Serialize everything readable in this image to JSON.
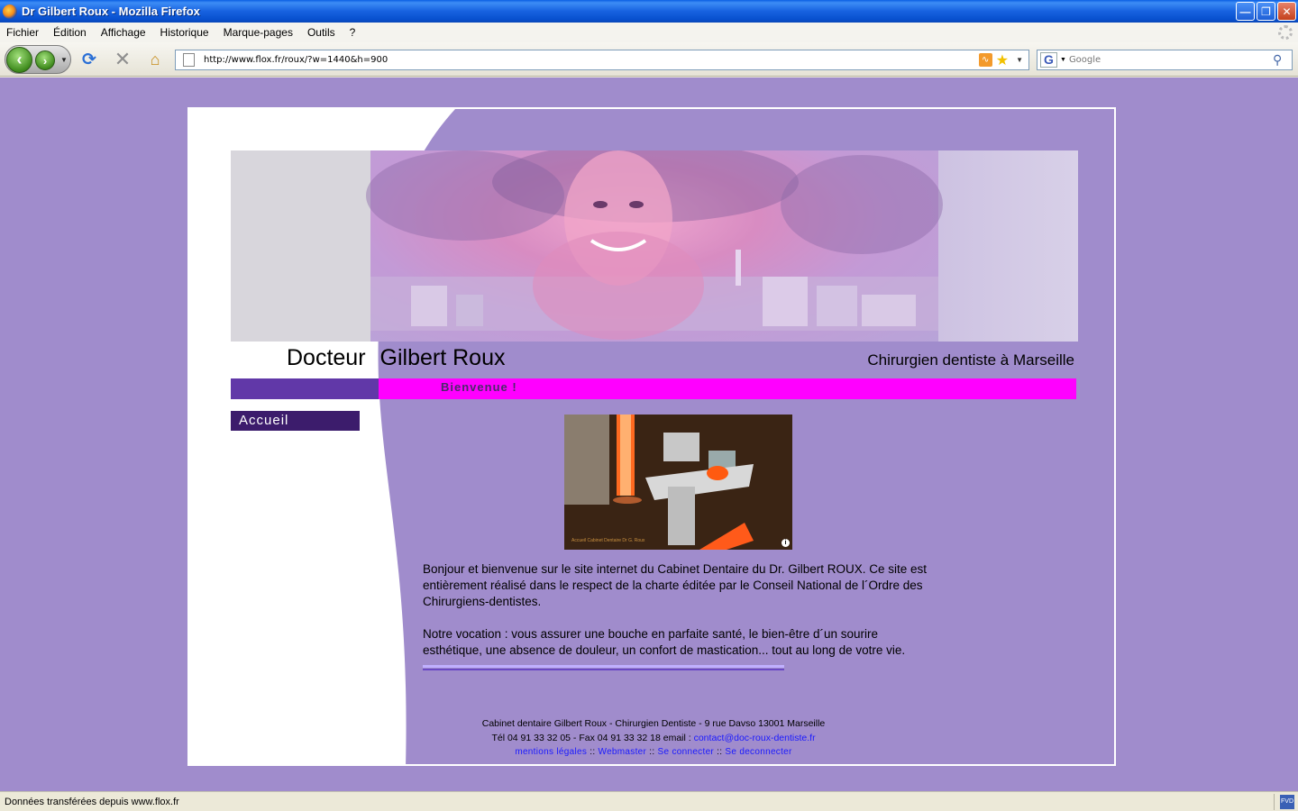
{
  "window": {
    "title": "Dr Gilbert Roux - Mozilla Firefox",
    "buttons": [
      "minimize",
      "restore",
      "close"
    ]
  },
  "menubar": {
    "items": [
      "Fichier",
      "Édition",
      "Affichage",
      "Historique",
      "Marque-pages",
      "Outils",
      "?"
    ]
  },
  "navbar": {
    "url": "http://www.flox.fr/roux/?w=1440&h=900",
    "search_placeholder": "Google"
  },
  "page": {
    "doctor_title": "Docteur",
    "doctor_name": "Gilbert Roux",
    "specialty": "Chirurgien dentiste à Marseille",
    "welcome": "Bienvenue !",
    "nav": {
      "accueil": "Accueil"
    },
    "paragraph1": "Bonjour et bienvenue sur le site internet du Cabinet Dentaire du Dr. Gilbert ROUX. Ce site est entièrement réalisé dans le respect de la charte éditée par le Conseil National de l´Ordre des Chirurgiens-dentistes.",
    "paragraph2": "Notre vocation : vous assurer une bouche en parfaite santé, le bien-être d´un sourire esthétique, une absence de douleur, un confort de mastication... tout au long de votre vie.",
    "photo_caption": "Accueil Cabinet Dentaire Dr G. Roux",
    "footer": {
      "address": "Cabinet dentaire Gilbert Roux - Chirurgien Dentiste - 9 rue Davso 13001 Marseille",
      "phone_prefix": "Tél 04 91 33 32 05 - Fax 04 91 33 32 18 email :",
      "email": "contact@doc-roux-dentiste.fr",
      "links": {
        "mentions": "mentions légales",
        "webmaster": "Webmaster",
        "login": "Se connecter",
        "logout": "Se deconnecter",
        "separator": "::"
      }
    }
  },
  "status": {
    "text": "Données transférées depuis www.flox.fr",
    "addon_label": "FVD"
  },
  "colors": {
    "page_bg": "#a08ccc",
    "magenta_bar": "#ff00ff",
    "purple_bar": "#6138a8",
    "menu_bg": "#3c1c6c",
    "link": "#1a1aff"
  }
}
